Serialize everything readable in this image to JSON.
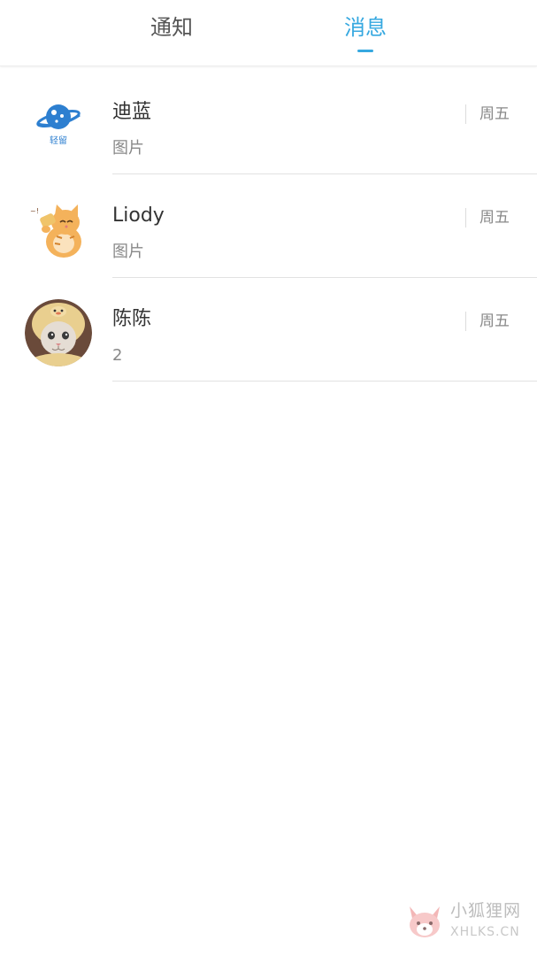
{
  "tabs": {
    "notice_label": "通知",
    "message_label": "消息",
    "active": "message",
    "active_color": "#36a8e0"
  },
  "conversations": [
    {
      "name": "迪蓝",
      "preview": "图片",
      "time": "周五",
      "avatar_icon": "planet-logo-icon",
      "avatar_caption": "轻留"
    },
    {
      "name": "Liody",
      "preview": "图片",
      "time": "周五",
      "avatar_icon": "cat-sticker-icon"
    },
    {
      "name": "陈陈",
      "preview": "2",
      "time": "周五",
      "avatar_icon": "cat-hat-photo"
    }
  ],
  "watermark": {
    "title": "小狐狸网",
    "subtitle": "XHLKS.CN",
    "icon": "fox-logo-icon"
  }
}
